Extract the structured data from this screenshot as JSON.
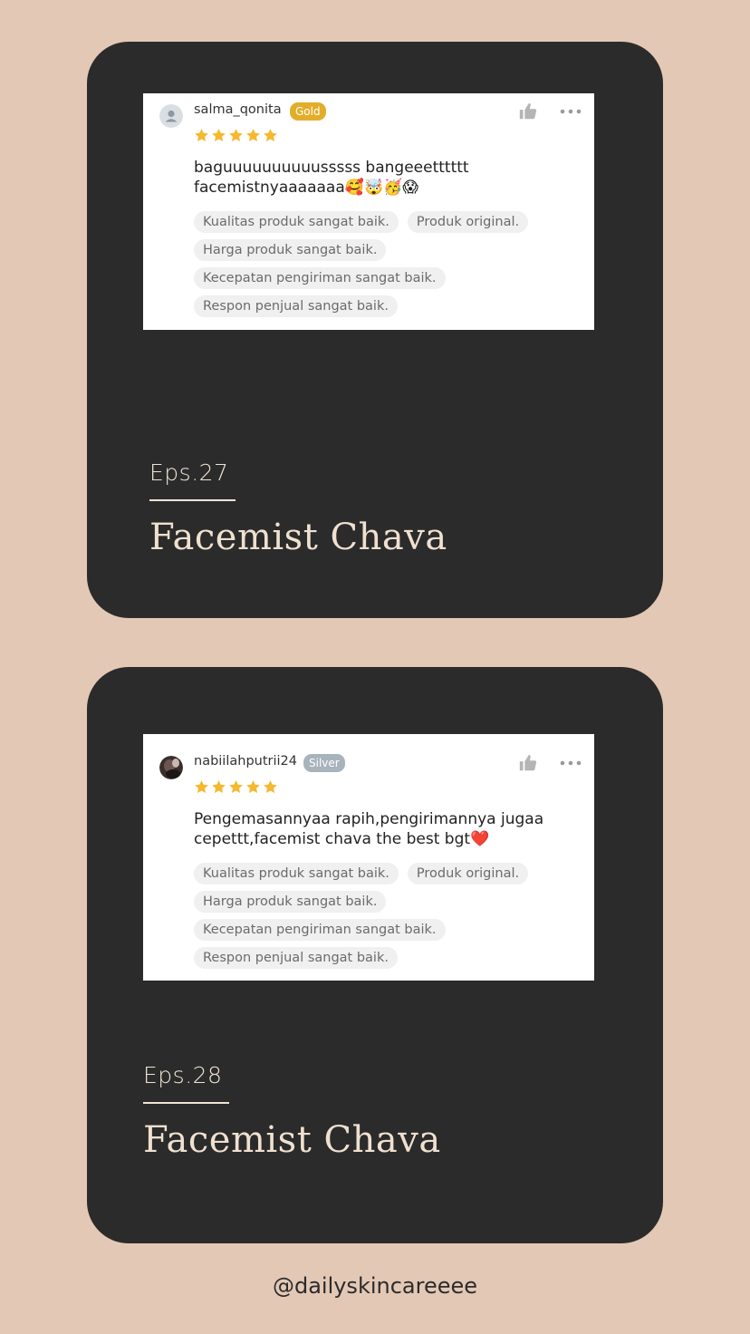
{
  "reviews": [
    {
      "username": "salma_qonita",
      "badge": "Gold",
      "rating": 5,
      "comment": "baguuuuuuuuuusssss bangeeetttttt facemistnyaaaaaaa🥰🤯🥳😱",
      "tags_row1": [
        "Kualitas produk sangat baik.",
        "Produk original."
      ],
      "tag_row2": "Harga produk sangat baik.",
      "tag_row3": "Kecepatan pengiriman sangat baik.",
      "tag_row4": "Respon penjual sangat baik.",
      "episode": "Eps.27",
      "title": "Facemist Chava"
    },
    {
      "username": "nabiilahputrii24",
      "badge": "Silver",
      "rating": 5,
      "comment": "Pengemasannyaa rapih,pengirimannya jugaa cepettt,facemist chava the best bgt❤️",
      "tags_row1": [
        "Kualitas produk sangat baik.",
        "Produk original."
      ],
      "tag_row2": "Harga produk sangat baik.",
      "tag_row3": "Kecepatan pengiriman sangat baik.",
      "tag_row4": "Respon penjual sangat baik.",
      "episode": "Eps.28",
      "title": "Facemist Chava"
    }
  ],
  "footer": "@dailyskincareeee",
  "colors": {
    "background": "#e4c8b6",
    "card": "#2b2b2b",
    "star": "#f5b82e",
    "gold_badge": "#e2ae2a",
    "silver_badge": "#a8b3bc"
  },
  "icons": [
    "user-avatar-icon",
    "thumbs-up-icon",
    "more-options-icon",
    "star-icon"
  ]
}
